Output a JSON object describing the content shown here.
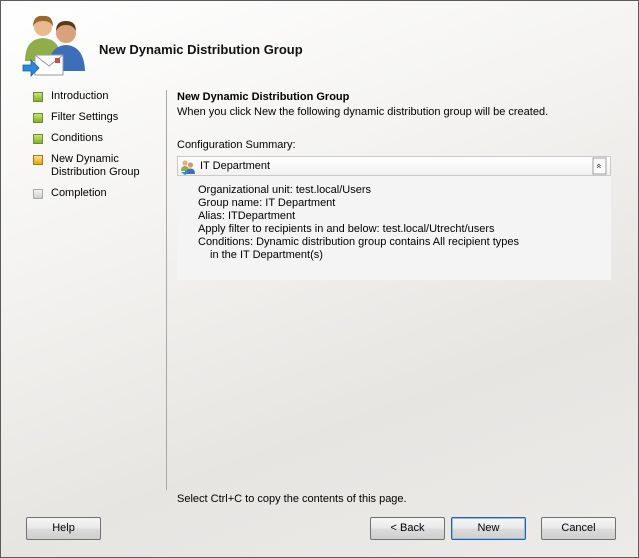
{
  "header": {
    "title": "New Dynamic Distribution Group",
    "icon": "users-mail-icon"
  },
  "steps": [
    {
      "label": "Introduction",
      "state": "completed"
    },
    {
      "label": "Filter Settings",
      "state": "completed"
    },
    {
      "label": "Conditions",
      "state": "completed"
    },
    {
      "label": "New Dynamic Distribution Group",
      "state": "current"
    },
    {
      "label": "Completion",
      "state": "pending"
    }
  ],
  "content": {
    "title": "New Dynamic Distribution Group",
    "description": "When you click New the following dynamic distribution group will be created.",
    "config_label": "Configuration Summary:",
    "summary": {
      "group_name": "IT Department",
      "collapse_glyph": "«",
      "lines": [
        "Organizational unit: test.local/Users",
        "Group name: IT Department",
        "Alias: ITDepartment",
        "Apply filter to recipients in and below: test.local/Utrecht/users",
        "Conditions: Dynamic distribution group contains All recipient types",
        "in the IT Department(s)"
      ]
    },
    "hint": "Select Ctrl+C to copy the contents of this page."
  },
  "buttons": {
    "help": "Help",
    "back": "< Back",
    "new": "New",
    "cancel": "Cancel"
  }
}
